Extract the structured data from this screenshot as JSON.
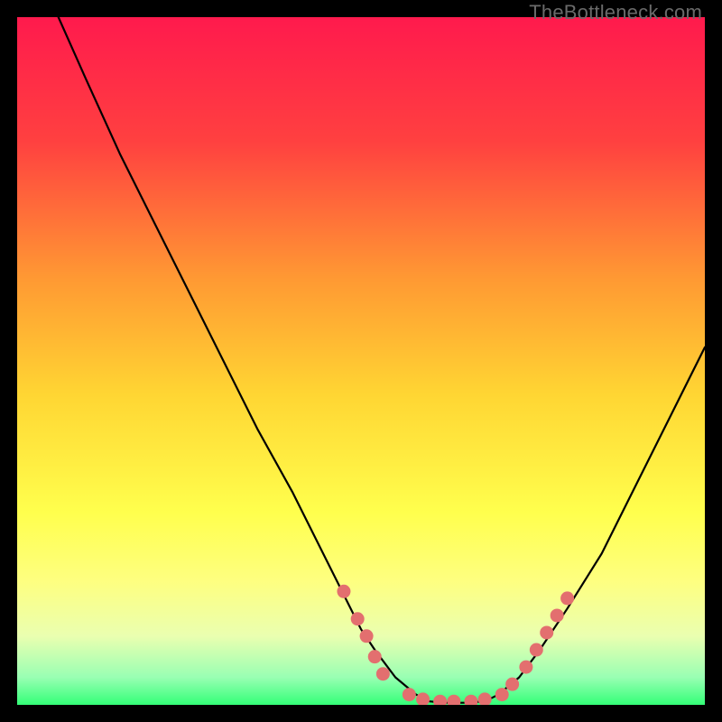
{
  "watermark": "TheBottleneck.com",
  "colors": {
    "black": "#000000",
    "line": "#000000",
    "dot": "#e36f6f",
    "grad_top": "#ff1a4d",
    "grad_upper_mid": "#ff7e33",
    "grad_mid": "#ffd633",
    "grad_lower": "#ffff66",
    "grad_light": "#f4ffb3",
    "grad_green": "#33ff77"
  },
  "chart_data": {
    "type": "line",
    "title": "",
    "xlabel": "",
    "ylabel": "",
    "xlim": [
      0,
      100
    ],
    "ylim": [
      0,
      100
    ],
    "x": [
      6,
      10,
      15,
      20,
      25,
      30,
      35,
      40,
      45,
      48,
      50,
      52,
      55,
      58,
      60,
      62,
      65,
      68,
      70,
      73,
      76,
      80,
      85,
      90,
      95,
      100
    ],
    "y": [
      100,
      91,
      80,
      70,
      60,
      50,
      40,
      31,
      21,
      15,
      11,
      8,
      4,
      1.5,
      0.5,
      0.3,
      0.3,
      0.5,
      1.5,
      4,
      8,
      14,
      22,
      32,
      42,
      52
    ],
    "dots": [
      {
        "x": 47.5,
        "y": 16.5
      },
      {
        "x": 49.5,
        "y": 12.5
      },
      {
        "x": 50.8,
        "y": 10.0
      },
      {
        "x": 52.0,
        "y": 7.0
      },
      {
        "x": 53.2,
        "y": 4.5
      },
      {
        "x": 57.0,
        "y": 1.5
      },
      {
        "x": 59.0,
        "y": 0.8
      },
      {
        "x": 61.5,
        "y": 0.5
      },
      {
        "x": 63.5,
        "y": 0.5
      },
      {
        "x": 66.0,
        "y": 0.5
      },
      {
        "x": 68.0,
        "y": 0.8
      },
      {
        "x": 70.5,
        "y": 1.5
      },
      {
        "x": 72.0,
        "y": 3.0
      },
      {
        "x": 74.0,
        "y": 5.5
      },
      {
        "x": 75.5,
        "y": 8.0
      },
      {
        "x": 77.0,
        "y": 10.5
      },
      {
        "x": 78.5,
        "y": 13.0
      },
      {
        "x": 80.0,
        "y": 15.5
      }
    ]
  }
}
